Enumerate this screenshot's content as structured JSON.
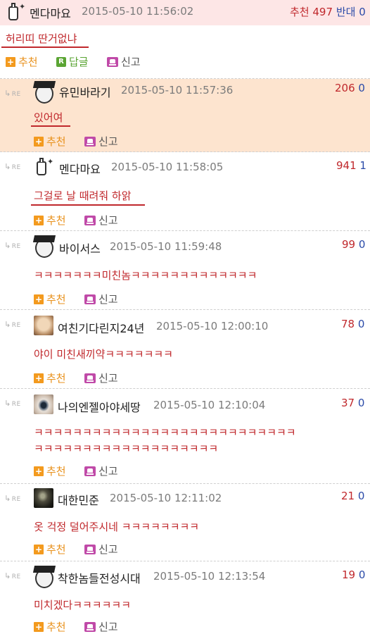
{
  "top_post": {
    "author": "멘다마요",
    "date": "2015-05-10 11:56:02",
    "upvote_label": "추천",
    "upvotes": "497",
    "downvote_label": "반대",
    "downvotes": "0",
    "text": "허리띠 딴거없냐",
    "actions": {
      "recommend": "추천",
      "reply": "답글",
      "report": "신고"
    }
  },
  "comments": [
    {
      "author": "유민바라기",
      "date": "2015-05-10 11:57:36",
      "up": "206",
      "down": "0",
      "text": "있어여",
      "text2": "",
      "highlight": true,
      "avatar": "graduate"
    },
    {
      "author": "멘다마요",
      "date": "2015-05-10 11:58:05",
      "up": "941",
      "down": "1",
      "text": "그걸로 날 때려줘 하앍",
      "text2": "",
      "highlight": false,
      "avatar": "bottle"
    },
    {
      "author": "바이서스",
      "date": "2015-05-10 11:59:48",
      "up": "99",
      "down": "0",
      "text": "ㅋㅋㅋㅋㅋㅋㅋ미친놈ㅋㅋㅋㅋㅋㅋㅋㅋㅋㅋㅋㅋㅋ",
      "text2": "",
      "highlight": false,
      "avatar": "graduate"
    },
    {
      "author": "여친기다린지24년",
      "date": "2015-05-10 12:00:10",
      "up": "78",
      "down": "0",
      "text": "야이 미친새끼약ㅋㅋㅋㅋㅋㅋㅋ",
      "text2": "",
      "highlight": false,
      "avatar": "photo-face"
    },
    {
      "author": "나의엔젤아야세땅",
      "date": "2015-05-10 12:10:04",
      "up": "37",
      "down": "0",
      "text": "ㅋㅋㅋㅋㅋㅋㅋㅋㅋㅋㅋㅋㅋㅋㅋㅋㅋㅋㅋㅋㅋㅋㅋㅋㅋㅋㅋ",
      "text2": "ㅋㅋㅋㅋㅋㅋㅋㅋㅋㅋㅋㅋㅋㅋㅋㅋㅋㅋㅋ",
      "highlight": false,
      "avatar": "photo-eye"
    },
    {
      "author": "대한민준",
      "date": "2015-05-10 12:11:02",
      "up": "21",
      "down": "0",
      "text": "옷 걱정 덜어주시네 ㅋㅋㅋㅋㅋㅋㅋㅋ",
      "text2": "",
      "highlight": false,
      "avatar": "photo-dark"
    },
    {
      "author": "착한놈들전성시대",
      "date": "2015-05-10 12:13:54",
      "up": "19",
      "down": "0",
      "text": "미치겠다ㅋㅋㅋㅋㅋㅋ",
      "text2": "",
      "highlight": false,
      "avatar": "graduate"
    }
  ],
  "actions": {
    "recommend": "추천",
    "report": "신고",
    "re_marker": "RE"
  },
  "colors": {
    "accent_red": "#c0282c",
    "accent_blue": "#2a4aa8",
    "highlight_bg": "#fde4cf",
    "header_bg": "#fde6e6",
    "recommend_orange": "#e8911c"
  }
}
